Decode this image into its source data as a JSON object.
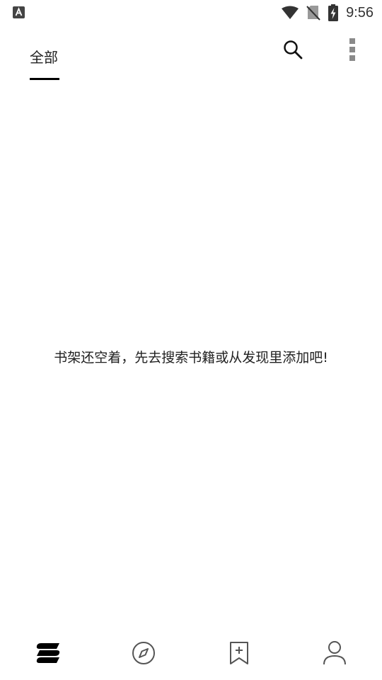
{
  "status_bar": {
    "time": "9:56",
    "icons": [
      "notification-a-icon",
      "wifi-icon",
      "no-sim-icon",
      "battery-charging-icon"
    ]
  },
  "top_bar": {
    "tabs": [
      {
        "label": "全部",
        "selected": true
      }
    ],
    "actions": [
      "search-icon",
      "more-vertical-icon"
    ]
  },
  "main": {
    "empty_message": "书架还空着，先去搜索书籍或从发现里添加吧!"
  },
  "bottom_nav": {
    "items": [
      {
        "icon": "bookshelf-icon",
        "selected": true
      },
      {
        "icon": "compass-icon",
        "selected": false
      },
      {
        "icon": "bookmark-add-icon",
        "selected": false
      },
      {
        "icon": "person-icon",
        "selected": false
      }
    ]
  },
  "colors": {
    "background": "#ffffff",
    "text_primary": "#212121",
    "icon_active": "#000000",
    "icon_inactive": "#555555"
  }
}
